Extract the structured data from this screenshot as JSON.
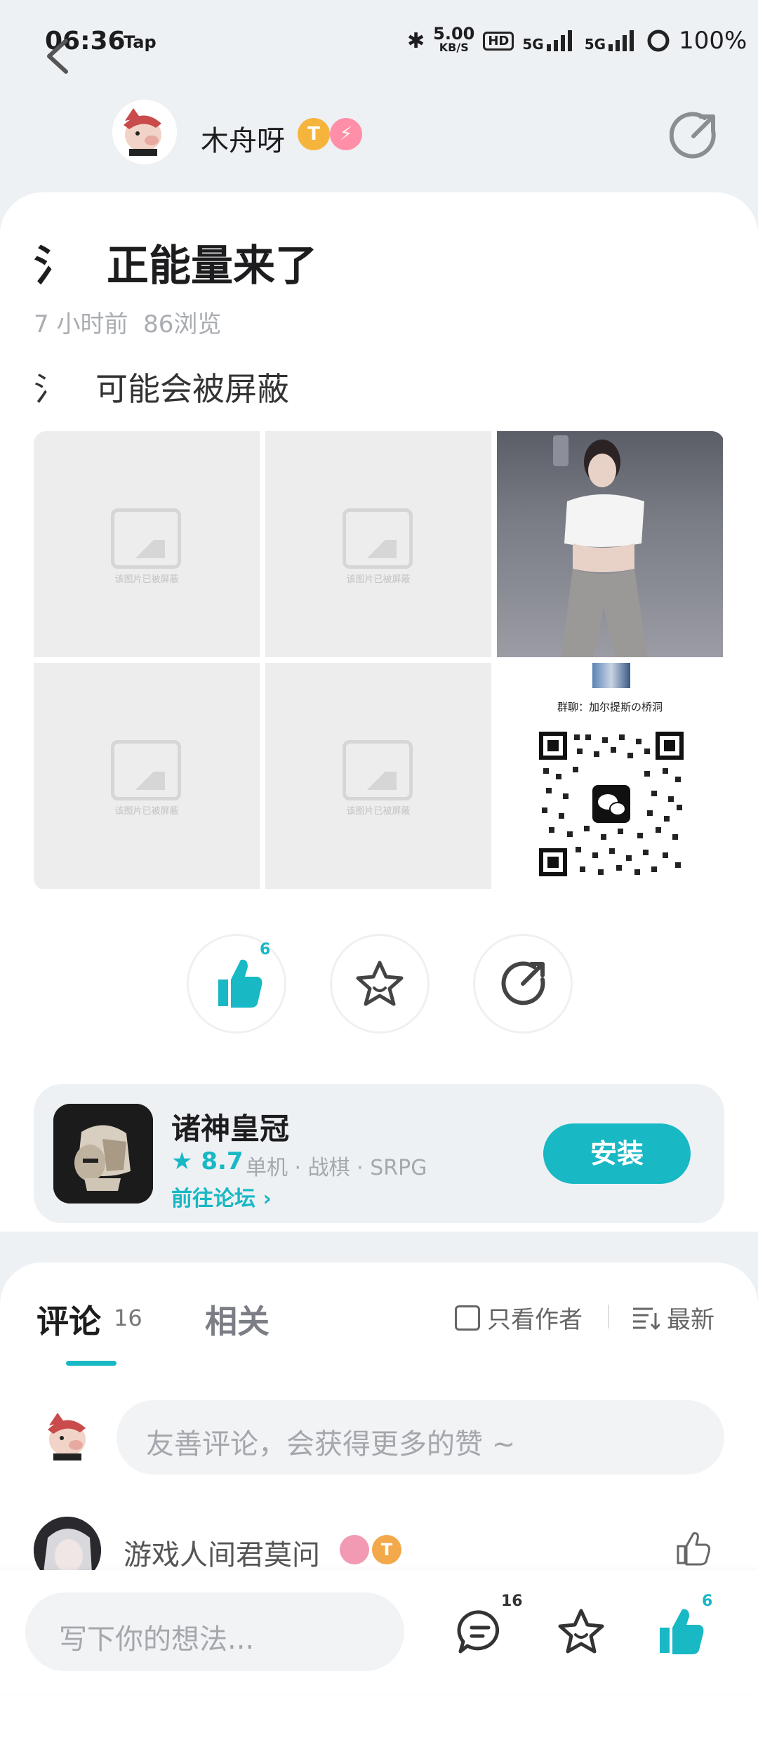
{
  "status_bar": {
    "time": "06:36",
    "app_label": "Tap",
    "net_speed_value": "5.00",
    "net_speed_unit": "KB/S",
    "hd_label": "HD",
    "net_type_1": "5G",
    "net_type_2": "5G",
    "battery": "100%"
  },
  "header": {
    "author_name": "木舟呀",
    "badge_t": "T"
  },
  "post": {
    "title_prefix": "氵",
    "title": "正能量来了",
    "time_ago": "7 小时前",
    "views": "86浏览",
    "subtitle_prefix": "氵",
    "subtitle": "可能会被屏蔽",
    "blocked_caption": "该图片已被屏蔽",
    "qr_group_label": "群聊：加尔提斯の桥洞"
  },
  "actions": {
    "like_count": "6"
  },
  "app_card": {
    "name": "诸神皇冠",
    "rating": "8.7",
    "tags": "单机 · 战棋 · SRPG",
    "forum_link": "前往论坛",
    "install_label": "安装"
  },
  "comments": {
    "tab_comments": "评论",
    "comments_count": "16",
    "tab_related": "相关",
    "only_author": "只看作者",
    "sort": "最新",
    "input_placeholder": "友善评论，会获得更多的赞 ~",
    "first_comment_user": "游戏人间君莫问",
    "first_comment_badge": "T"
  },
  "bottom_bar": {
    "input_placeholder": "写下你的想法...",
    "comment_count": "16",
    "like_count": "6"
  },
  "colors": {
    "accent": "#18b8c4",
    "background": "#eef1f4"
  }
}
